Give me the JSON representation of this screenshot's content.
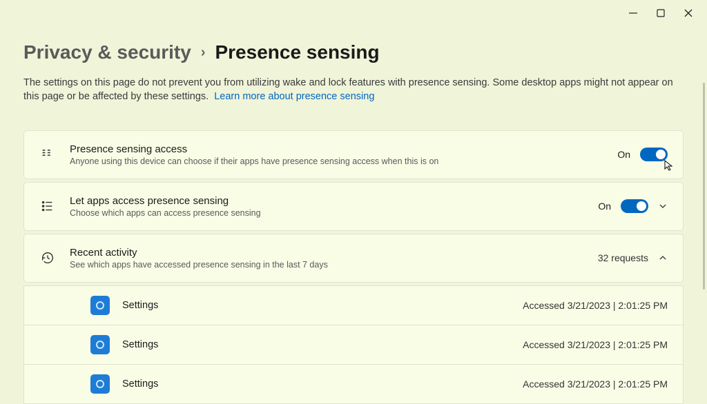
{
  "window_controls": {
    "min": "minimize",
    "max": "maximize",
    "close": "close"
  },
  "breadcrumb": {
    "parent": "Privacy & security",
    "current": "Presence sensing"
  },
  "description_text": "The settings on this page do not prevent you from utilizing wake and lock features with presence sensing. Some desktop apps might not appear on this page or be affected by these settings.",
  "learn_more_link": "Learn more about presence sensing",
  "cards": {
    "access": {
      "title": "Presence sensing access",
      "sub": "Anyone using this device can choose if their apps have presence sensing access when this is on",
      "state_label": "On",
      "state": true
    },
    "apps": {
      "title": "Let apps access presence sensing",
      "sub": "Choose which apps can access presence sensing",
      "state_label": "On",
      "state": true
    },
    "recent": {
      "title": "Recent activity",
      "sub": "See which apps have accessed presence sensing in the last 7 days",
      "count_label": "32 requests"
    }
  },
  "activity": [
    {
      "app": "Settings",
      "accessed": "Accessed 3/21/2023  |  2:01:25 PM"
    },
    {
      "app": "Settings",
      "accessed": "Accessed 3/21/2023  |  2:01:25 PM"
    },
    {
      "app": "Settings",
      "accessed": "Accessed 3/21/2023  |  2:01:25 PM"
    }
  ]
}
